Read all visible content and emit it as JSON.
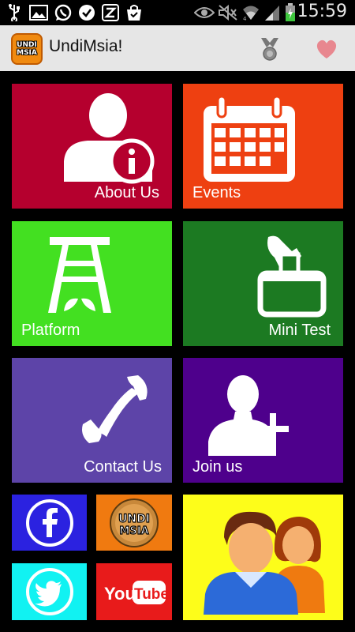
{
  "status_bar": {
    "time": "15:59",
    "icons": [
      "usb-icon",
      "image-icon",
      "whatsapp-icon",
      "check-icon",
      "z-icon",
      "bag-icon",
      "eye-icon",
      "mute-icon",
      "wifi-icon",
      "signal-icon",
      "battery-icon"
    ]
  },
  "action_bar": {
    "title": "UndiMsia!",
    "logo_text_top": "UNDI",
    "logo_text_bottom": "MSIA",
    "actions": [
      "medal-icon",
      "heart-icon"
    ]
  },
  "tiles": [
    {
      "id": "about-us",
      "label": "About Us",
      "color": "#b5002e",
      "icon": "user-info-icon"
    },
    {
      "id": "events",
      "label": "Events",
      "color": "#ee4011",
      "icon": "calendar-icon"
    },
    {
      "id": "platform",
      "label": "Platform",
      "color": "#43e021",
      "icon": "ladder-icon"
    },
    {
      "id": "mini-test",
      "label": "Mini Test",
      "color": "#1c7a22",
      "icon": "ballot-box-icon"
    },
    {
      "id": "contact-us",
      "label": "Contact Us",
      "color": "#5d44a8",
      "icon": "phone-icon"
    },
    {
      "id": "join-us",
      "label": "Join us",
      "color": "#4e008c",
      "icon": "add-user-icon"
    }
  ],
  "small_tiles": [
    {
      "id": "facebook",
      "color": "#2b22e0",
      "icon": "facebook-icon"
    },
    {
      "id": "undimsia",
      "color": "#f07a10",
      "icon": "undimsia-logo-icon",
      "text_top": "UNDI",
      "text_bottom": "MSIA"
    },
    {
      "id": "twitter",
      "color": "#11f2f2",
      "icon": "twitter-icon"
    },
    {
      "id": "youtube",
      "color": "#e81b1b",
      "icon": "youtube-icon",
      "text_you": "You",
      "text_tube": "Tube"
    }
  ],
  "people_tile": {
    "color": "#fdfd1a",
    "icon": "people-icon"
  }
}
